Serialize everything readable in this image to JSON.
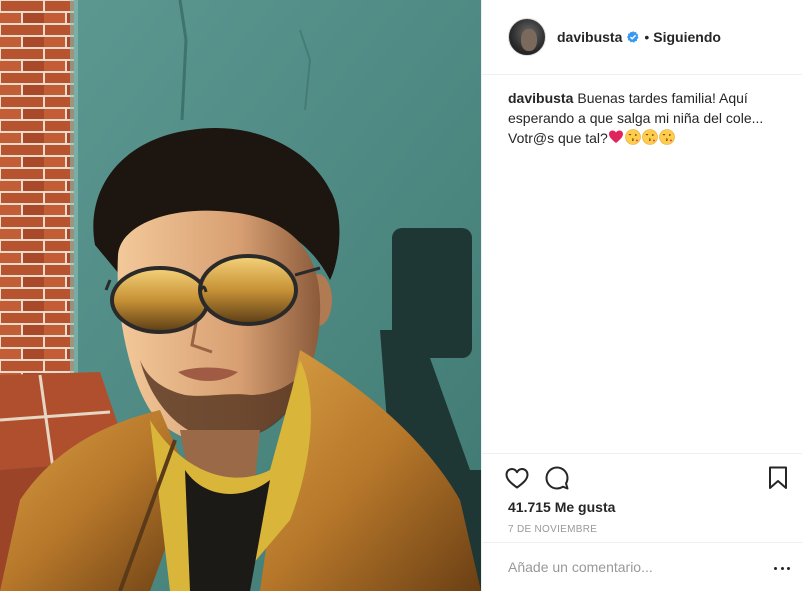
{
  "post": {
    "author": {
      "username": "davibusta",
      "verified": true,
      "separator": "•",
      "follow_status": "Siguiendo"
    },
    "caption": {
      "username": "davibusta",
      "text": "Buenas tardes familia! Aquí esperando a que salga mi niña del cole... Votr@s que tal?",
      "emojis": [
        "heart-emoji",
        "kiss-face-emoji",
        "kiss-face-emoji",
        "kiss-face-emoji"
      ]
    },
    "likes": "41.715 Me gusta",
    "date": "7 DE NOVIEMBRE",
    "comment": {
      "placeholder": "Añade un comentario...",
      "value": ""
    }
  },
  "colors": {
    "verified_badge": "#3897f0",
    "heart_emoji": "#e0245e",
    "text": "#262626",
    "muted": "#999999"
  }
}
